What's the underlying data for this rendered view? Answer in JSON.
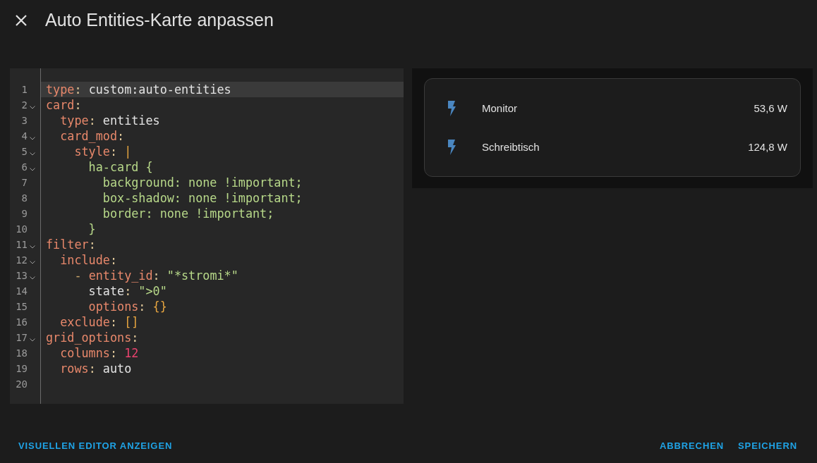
{
  "dialog": {
    "title": "Auto Entities-Karte anpassen"
  },
  "editor": {
    "lines": [
      {
        "number": "1",
        "foldable": false,
        "active": true,
        "tokens": [
          {
            "kind": "key",
            "text": "type"
          },
          {
            "kind": "punct",
            "text": ": "
          },
          {
            "kind": "plain",
            "text": "custom:auto-entities"
          }
        ]
      },
      {
        "number": "2",
        "foldable": true,
        "active": false,
        "tokens": [
          {
            "kind": "key",
            "text": "card"
          },
          {
            "kind": "punct",
            "text": ":"
          }
        ]
      },
      {
        "number": "3",
        "foldable": false,
        "active": false,
        "tokens": [
          {
            "kind": "key",
            "text": "  type"
          },
          {
            "kind": "punct",
            "text": ": "
          },
          {
            "kind": "plain",
            "text": "entities"
          }
        ]
      },
      {
        "number": "4",
        "foldable": true,
        "active": false,
        "tokens": [
          {
            "kind": "key",
            "text": "  card_mod"
          },
          {
            "kind": "punct",
            "text": ":"
          }
        ]
      },
      {
        "number": "5",
        "foldable": true,
        "active": false,
        "tokens": [
          {
            "kind": "key",
            "text": "    style"
          },
          {
            "kind": "punct",
            "text": ": "
          },
          {
            "kind": "bracket",
            "text": "|"
          }
        ]
      },
      {
        "number": "6",
        "foldable": true,
        "active": false,
        "tokens": [
          {
            "kind": "string",
            "text": "      ha-card {"
          }
        ]
      },
      {
        "number": "7",
        "foldable": false,
        "active": false,
        "tokens": [
          {
            "kind": "string",
            "text": "        background: none !important;"
          }
        ]
      },
      {
        "number": "8",
        "foldable": false,
        "active": false,
        "tokens": [
          {
            "kind": "string",
            "text": "        box-shadow: none !important;"
          }
        ]
      },
      {
        "number": "9",
        "foldable": false,
        "active": false,
        "tokens": [
          {
            "kind": "string",
            "text": "        border: none !important;"
          }
        ]
      },
      {
        "number": "10",
        "foldable": false,
        "active": false,
        "tokens": [
          {
            "kind": "string",
            "text": "      }"
          }
        ]
      },
      {
        "number": "11",
        "foldable": true,
        "active": false,
        "tokens": [
          {
            "kind": "key",
            "text": "filter"
          },
          {
            "kind": "punct",
            "text": ":"
          }
        ]
      },
      {
        "number": "12",
        "foldable": true,
        "active": false,
        "tokens": [
          {
            "kind": "key",
            "text": "  include"
          },
          {
            "kind": "punct",
            "text": ":"
          }
        ]
      },
      {
        "number": "13",
        "foldable": true,
        "active": false,
        "tokens": [
          {
            "kind": "dash",
            "text": "    - "
          },
          {
            "kind": "key",
            "text": "entity_id"
          },
          {
            "kind": "punct",
            "text": ": "
          },
          {
            "kind": "string",
            "text": "\"*stromi*\""
          }
        ]
      },
      {
        "number": "14",
        "foldable": false,
        "active": false,
        "tokens": [
          {
            "kind": "plain",
            "text": "      state"
          },
          {
            "kind": "punct",
            "text": ": "
          },
          {
            "kind": "string",
            "text": "\">0\""
          }
        ]
      },
      {
        "number": "15",
        "foldable": false,
        "active": false,
        "tokens": [
          {
            "kind": "key",
            "text": "      options"
          },
          {
            "kind": "punct",
            "text": ": "
          },
          {
            "kind": "bracket",
            "text": "{}"
          }
        ]
      },
      {
        "number": "16",
        "foldable": false,
        "active": false,
        "tokens": [
          {
            "kind": "key",
            "text": "  exclude"
          },
          {
            "kind": "punct",
            "text": ": "
          },
          {
            "kind": "bracket",
            "text": "[]"
          }
        ]
      },
      {
        "number": "17",
        "foldable": true,
        "active": false,
        "tokens": [
          {
            "kind": "key",
            "text": "grid_options"
          },
          {
            "kind": "punct",
            "text": ":"
          }
        ]
      },
      {
        "number": "18",
        "foldable": false,
        "active": false,
        "tokens": [
          {
            "kind": "key",
            "text": "  columns"
          },
          {
            "kind": "punct",
            "text": ": "
          },
          {
            "kind": "number",
            "text": "12"
          }
        ]
      },
      {
        "number": "19",
        "foldable": false,
        "active": false,
        "tokens": [
          {
            "kind": "key",
            "text": "  rows"
          },
          {
            "kind": "punct",
            "text": ": "
          },
          {
            "kind": "plain",
            "text": "auto"
          }
        ]
      },
      {
        "number": "20",
        "foldable": false,
        "active": false
      }
    ]
  },
  "preview": {
    "entities": [
      {
        "name": "Monitor",
        "value": "53,6 W"
      },
      {
        "name": "Schreibtisch",
        "value": "124,8 W"
      }
    ]
  },
  "footer": {
    "left_button": "VISUELLEN EDITOR ANZEIGEN",
    "right_buttons": [
      "ABBRECHEN",
      "SPEICHERN"
    ]
  }
}
